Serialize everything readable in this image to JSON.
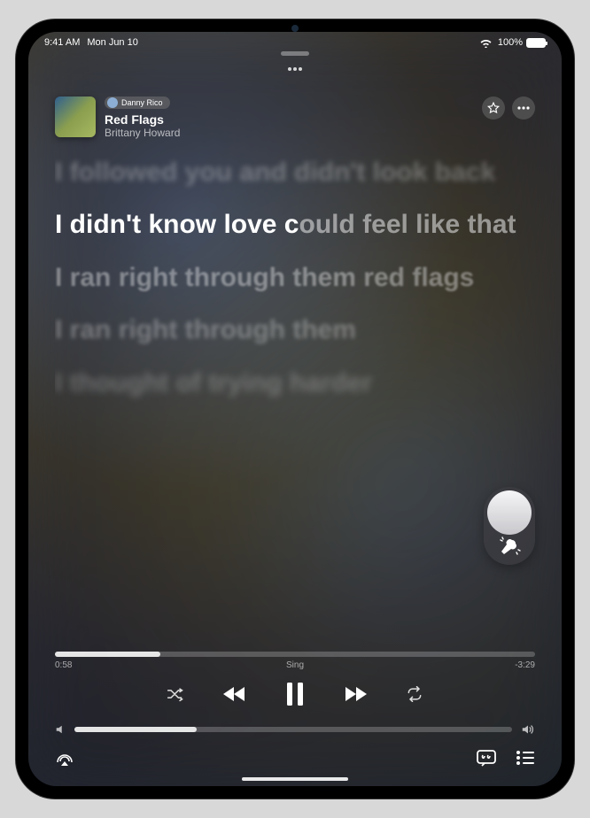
{
  "status": {
    "time": "9:41 AM",
    "date": "Mon Jun 10",
    "battery_pct": "100%"
  },
  "nowplaying": {
    "user": "Danny Rico",
    "title": "Red Flags",
    "artist": "Brittany Howard"
  },
  "lyrics": {
    "lines": [
      "I followed you and didn't look back",
      "",
      "I ran right through them red flags",
      "I ran right through them",
      "I thought of trying harder"
    ],
    "current_sung": "I didn't know love c",
    "current_rest": "ould feel like that"
  },
  "playback": {
    "elapsed": "0:58",
    "mode": "Sing",
    "remaining": "-3:29"
  }
}
